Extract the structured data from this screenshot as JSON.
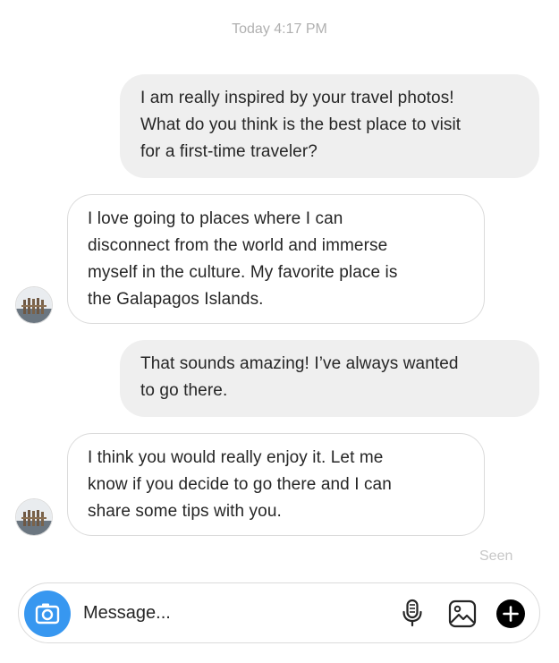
{
  "thread": {
    "timestamp": "Today 4:17 PM",
    "seen_label": "Seen"
  },
  "messages": [
    {
      "from": "me",
      "lines": [
        "I am really inspired by your travel photos!",
        "What do you think is the best place to visit",
        "for a first-time traveler?"
      ]
    },
    {
      "from": "them",
      "lines": [
        "I love going to places where I can",
        "disconnect from the world and immerse",
        "myself in the culture. My favorite place is",
        "the Galapagos Islands."
      ]
    },
    {
      "from": "me",
      "lines": [
        "That sounds amazing! I’ve always wanted",
        "to go there."
      ]
    },
    {
      "from": "them",
      "lines": [
        "I think you would really enjoy it. Let me",
        "know if you decide to go there and I can",
        "share some tips with you."
      ]
    }
  ],
  "composer": {
    "placeholder": "Message...",
    "icons": [
      "camera-icon",
      "microphone-icon",
      "image-icon",
      "plus-icon"
    ]
  },
  "colors": {
    "sent_bubble": "#efefef",
    "received_border": "#dbdbdb",
    "camera_button": "#3797f0",
    "text": "#262626"
  }
}
